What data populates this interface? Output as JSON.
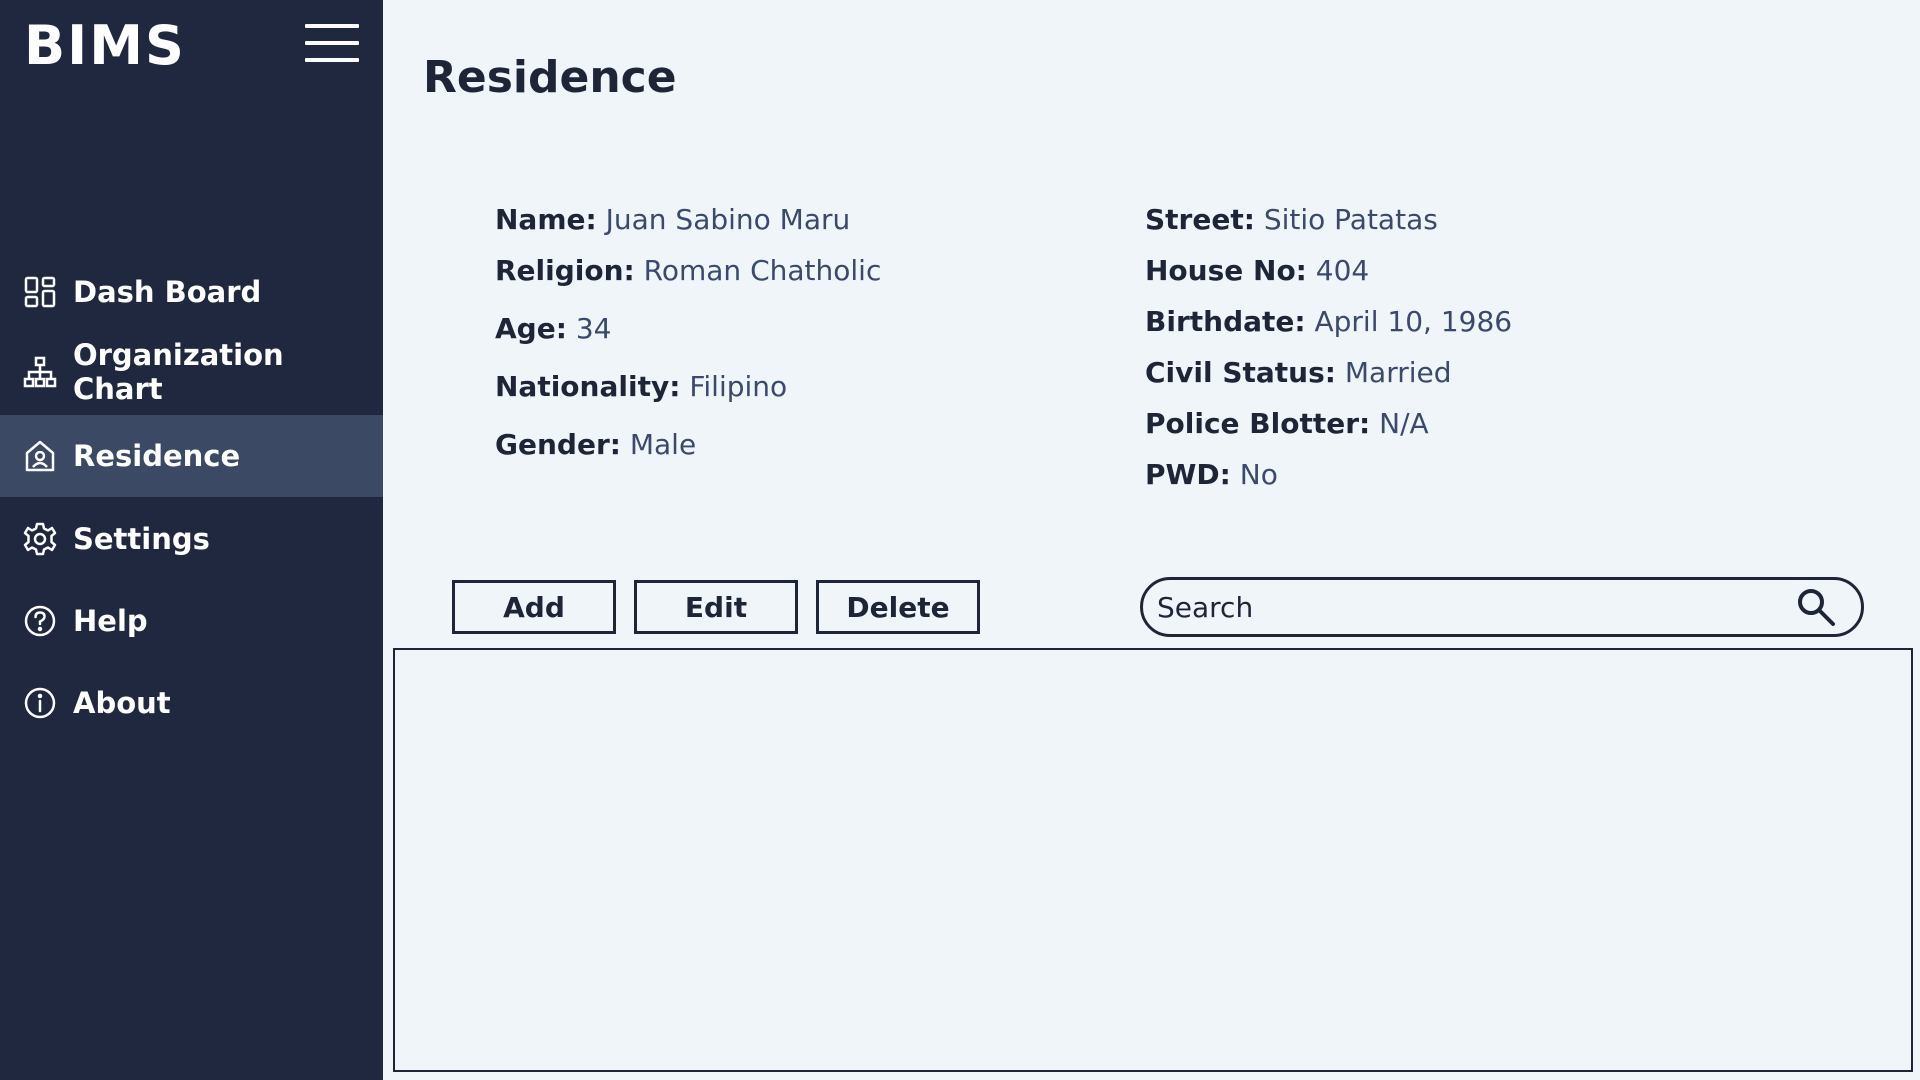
{
  "app": {
    "brand": "BIMS"
  },
  "sidebar": {
    "items": [
      {
        "label": "Dash Board",
        "icon": "dashboard-icon",
        "active": false
      },
      {
        "label": "Organization Chart",
        "icon": "org-chart-icon",
        "active": false
      },
      {
        "label": "Residence",
        "icon": "house-icon",
        "active": true
      },
      {
        "label": "Settings",
        "icon": "gear-icon",
        "active": false
      },
      {
        "label": "Help",
        "icon": "help-icon",
        "active": false
      },
      {
        "label": "About",
        "icon": "info-icon",
        "active": false
      }
    ]
  },
  "main": {
    "title": "Residence",
    "details_left": [
      {
        "key": "Name:",
        "value": "Juan Sabino Maru"
      },
      {
        "key": "Religion:",
        "value": "Roman Chatholic"
      },
      {
        "key": "Age:",
        "value": "34"
      },
      {
        "key": "Nationality:",
        "value": "Filipino"
      },
      {
        "key": "Gender:",
        "value": "Male"
      }
    ],
    "details_right": [
      {
        "key": "Street:",
        "value": "Sitio Patatas"
      },
      {
        "key": "House No:",
        "value": "404"
      },
      {
        "key": "Birthdate:",
        "value": "April 10, 1986"
      },
      {
        "key": "Civil Status:",
        "value": "Married"
      },
      {
        "key": "Police Blotter:",
        "value": "N/A"
      },
      {
        "key": "PWD:",
        "value": "No"
      }
    ],
    "actions": {
      "add": "Add",
      "edit": "Edit",
      "delete": "Delete"
    },
    "search": {
      "placeholder": "Search",
      "value": ""
    }
  },
  "colors": {
    "sidebar_bg": "#1f283f",
    "sidebar_active": "#3b4965",
    "page_bg": "#f0f5f9",
    "text_dark": "#1e2537",
    "value_text": "#3b4a6b"
  }
}
